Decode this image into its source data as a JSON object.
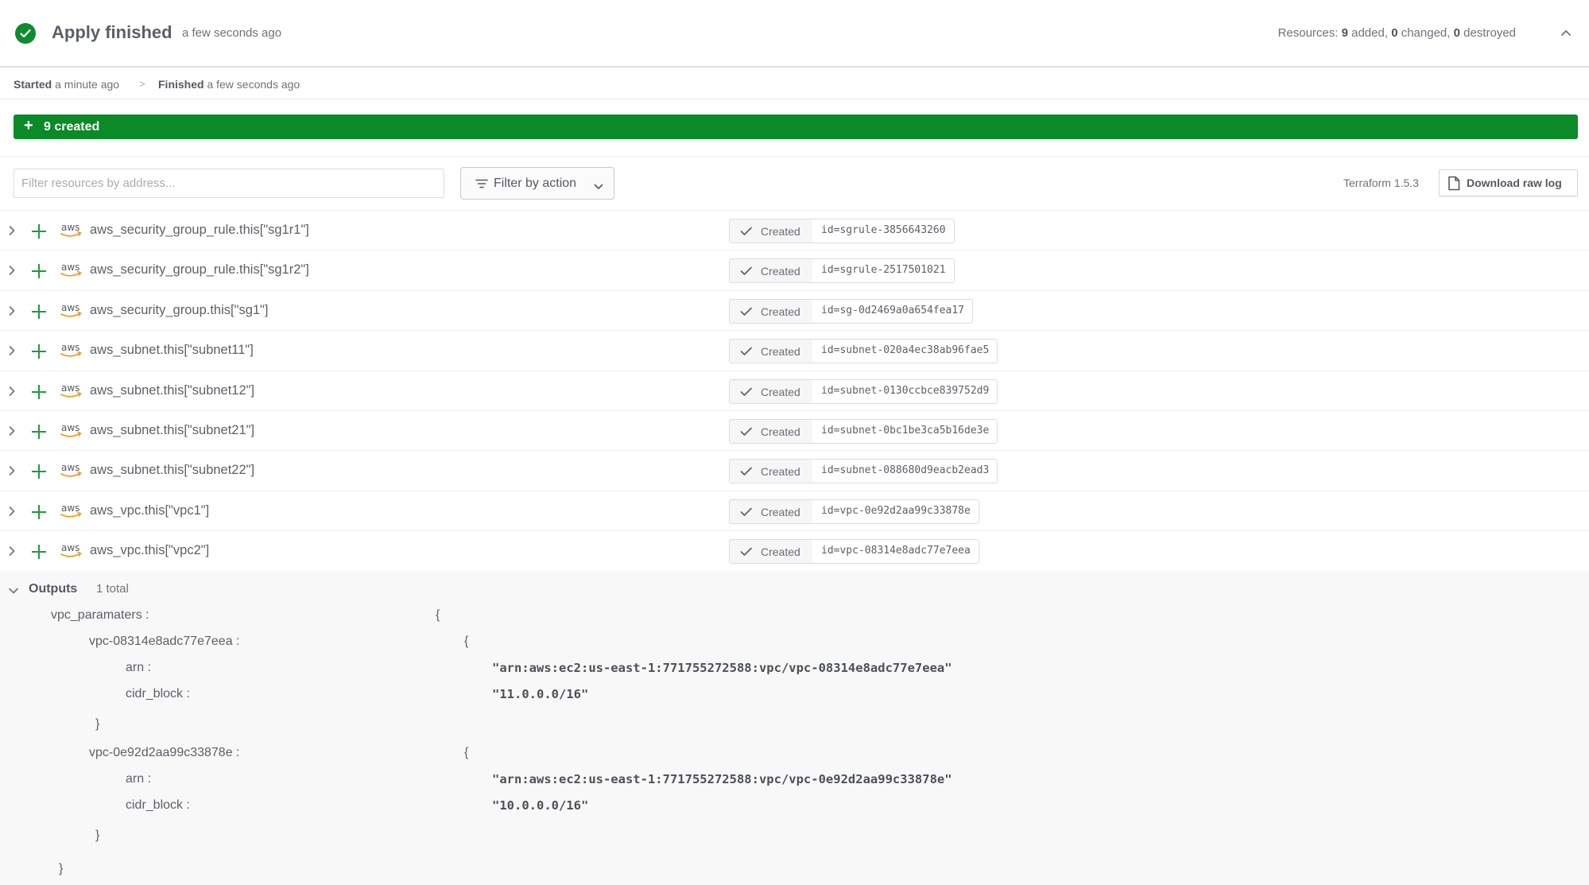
{
  "header": {
    "title": "Apply finished",
    "time": "a few seconds ago",
    "resources_prefix": "Resources:",
    "added": "9",
    "added_label": "added,",
    "changed": "0",
    "changed_label": "changed,",
    "destroyed": "0",
    "destroyed_label": "destroyed",
    "status_color": "#0f8a2e"
  },
  "breadcrumb": {
    "started_label": "Started",
    "started_time": "a minute ago",
    "separator": ">",
    "finished_label": "Finished",
    "finished_time": "a few seconds ago"
  },
  "summary_bar": {
    "icon": "+",
    "label": "9 created",
    "color": "#0b8a28"
  },
  "toolbar": {
    "filter_placeholder": "Filter resources by address...",
    "filter_value": "",
    "filter_action_label": "Filter by action",
    "terraform_version": "Terraform 1.5.3",
    "download_label": "Download raw log"
  },
  "resources": [
    {
      "address": "aws_security_group_rule.this[\"sg1r1\"]",
      "status": "Created",
      "id": "id=sgrule-3856643260"
    },
    {
      "address": "aws_security_group_rule.this[\"sg1r2\"]",
      "status": "Created",
      "id": "id=sgrule-2517501021"
    },
    {
      "address": "aws_security_group.this[\"sg1\"]",
      "status": "Created",
      "id": "id=sg-0d2469a0a654fea17"
    },
    {
      "address": "aws_subnet.this[\"subnet11\"]",
      "status": "Created",
      "id": "id=subnet-020a4ec38ab96fae5"
    },
    {
      "address": "aws_subnet.this[\"subnet12\"]",
      "status": "Created",
      "id": "id=subnet-0130ccbce839752d9"
    },
    {
      "address": "aws_subnet.this[\"subnet21\"]",
      "status": "Created",
      "id": "id=subnet-0bc1be3ca5b16de3e"
    },
    {
      "address": "aws_subnet.this[\"subnet22\"]",
      "status": "Created",
      "id": "id=subnet-088680d9eacb2ead3"
    },
    {
      "address": "aws_vpc.this[\"vpc1\"]",
      "status": "Created",
      "id": "id=vpc-0e92d2aa99c33878e"
    },
    {
      "address": "aws_vpc.this[\"vpc2\"]",
      "status": "Created",
      "id": "id=vpc-08314e8adc77e7eea"
    }
  ],
  "provider_logo": "aws",
  "outputs": {
    "title": "Outputs",
    "count": "1 total",
    "root_key": "vpc_paramaters :",
    "open_brace": "{",
    "close_brace": "}",
    "entries": [
      {
        "key": "vpc-08314e8adc77e7eea :",
        "arn_key": "arn :",
        "arn_value": "\"arn:aws:ec2:us-east-1:771755272588:vpc/vpc-08314e8adc77e7eea\"",
        "cidr_key": "cidr_block :",
        "cidr_value": "\"11.0.0.0/16\""
      },
      {
        "key": "vpc-0e92d2aa99c33878e :",
        "arn_key": "arn :",
        "arn_value": "\"arn:aws:ec2:us-east-1:771755272588:vpc/vpc-0e92d2aa99c33878e\"",
        "cidr_key": "cidr_block :",
        "cidr_value": "\"10.0.0.0/16\""
      }
    ]
  }
}
